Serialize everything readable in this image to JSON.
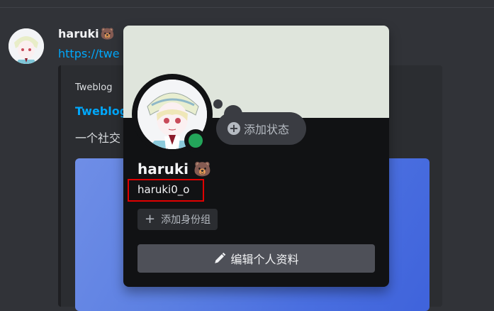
{
  "message": {
    "author": "haruki",
    "author_emoji": "🐻",
    "link_text": "https://twe",
    "embed": {
      "provider": "Tweblog",
      "title": "Tweblog",
      "description": "一个社交"
    }
  },
  "profile": {
    "display_name": "haruki",
    "name_emoji": "🐻",
    "username": "haruki0_o",
    "status_button": "添加状态",
    "add_role": "添加身份组",
    "edit_profile": "编辑个人资料",
    "status_color": "#23a55a",
    "highlight_color": "#e00000"
  },
  "icons": {
    "status_add": "plus-circle-icon",
    "role_add": "plus-icon",
    "edit": "pencil-icon"
  }
}
